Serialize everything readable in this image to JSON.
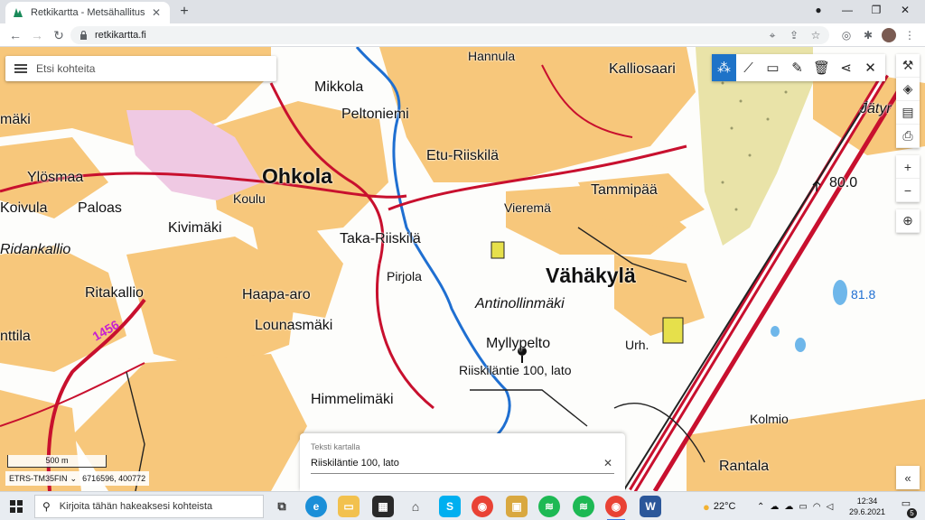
{
  "browser": {
    "tab_title": "Retkikartta - Metsähallitus",
    "url": "retkikartta.fi"
  },
  "search": {
    "placeholder": "Etsi kohteita"
  },
  "map": {
    "labels": {
      "hannula": "Hannula",
      "kalliosaari": "Kalliosaari",
      "mikkola": "Mikkola",
      "peltoniemi": "Peltoniemi",
      "maki": "mäki",
      "jatyr": "Jätyr",
      "etu_riiskila": "Etu-Riiskilä",
      "ohkola": "Ohkola",
      "ylosmaa": "Ylösmaa",
      "koivula": "Koivula",
      "paloas": "Paloas",
      "koulu": "Koulu",
      "vierema": "Vieremä",
      "tammipaa": "Tammipää",
      "height": "80.0",
      "kivimaki": "Kivimäki",
      "ridankallio": "Ridankallio",
      "taka_riiskila": "Taka-Riiskilä",
      "pirjola": "Pirjola",
      "vahakyla": "Vähäkylä",
      "ritakallio": "Ritakallio",
      "haapa_aro": "Haapa-aro",
      "antinollinmaki": "Antinollinmäki",
      "lounasmaki": "Lounasmäki",
      "road_number": "1456",
      "nttila": "nttila",
      "myllypelto": "Myllypelto",
      "urh": "Urh.",
      "marker_text": "Riiskiläntie 100, lato",
      "himmelimaki": "Himmelimäki",
      "kolmio": "Kolmio",
      "rantala": "Rantala",
      "height_818": "81.8"
    }
  },
  "scale": {
    "label": "500 m"
  },
  "coords": {
    "system": "ETRS-TM35FIN",
    "value": "6716596, 400772"
  },
  "text_card": {
    "caption": "Teksti kartalla",
    "value": "Riiskiläntie 100, lato"
  },
  "taskbar": {
    "search_placeholder": "Kirjoita tähän hakeaksesi kohteista",
    "temperature": "22°C",
    "time": "12:34",
    "date": "29.6.2021",
    "notification_count": "5"
  },
  "colors": {
    "field": "#f7c77b",
    "road": "#c8102e",
    "water": "#1f6fd1",
    "forest_dots": "#e9e3a8",
    "accent": "#1e73c8"
  }
}
